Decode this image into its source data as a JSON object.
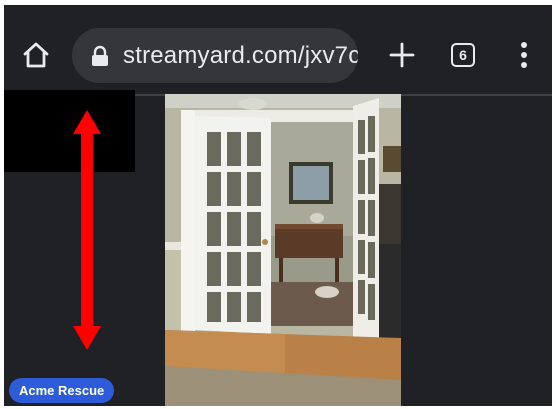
{
  "browser": {
    "url": "streamyard.com/jxv7c",
    "tab_count": "6",
    "icons": [
      "home-icon",
      "lock-icon",
      "plus-icon",
      "tab-switcher-icon",
      "more-vert-icon"
    ]
  },
  "stage": {
    "banner_label": "Acme Rescue",
    "arrow_color": "#ff0000",
    "badge_color": "#2e5bd8"
  }
}
